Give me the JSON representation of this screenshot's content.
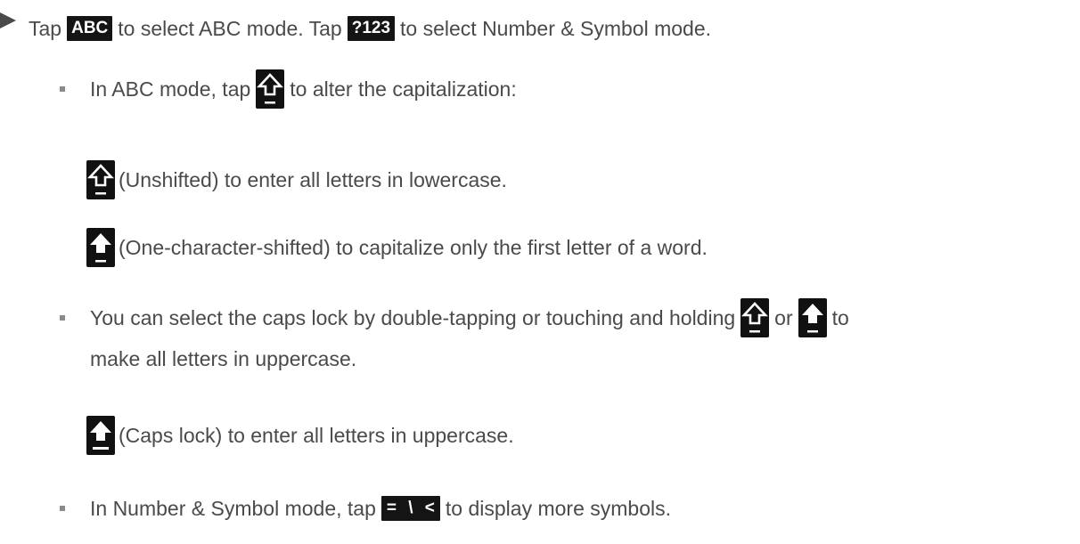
{
  "step": {
    "tap1": "Tap",
    "abc_key": "ABC",
    "mid1": "to select ABC mode. Tap",
    "num_key": "?123",
    "end1": "to select Number & Symbol mode."
  },
  "abc_mode": {
    "before": "In ABC mode, tap",
    "after": "to alter the capitalization:"
  },
  "unshifted": {
    "text": "(Unshifted) to enter all letters in lowercase."
  },
  "one_shift": {
    "text": "(One-character-shifted) to capitalize only the first letter of a word."
  },
  "caps_select": {
    "before": "You can select the caps lock by double-tapping or touching and holding",
    "or": "or",
    "to": "to",
    "line2": "make all letters in uppercase."
  },
  "caps_lock": {
    "text": "(Caps lock) to enter all letters in uppercase."
  },
  "number_mode": {
    "before": "In Number & Symbol mode, tap",
    "key": "= \\ <",
    "after": "to display more symbols."
  },
  "icons": {
    "shift_outline": "shift-outline-icon",
    "shift_filled": "shift-filled-icon",
    "caps_lock": "caps-lock-icon"
  }
}
